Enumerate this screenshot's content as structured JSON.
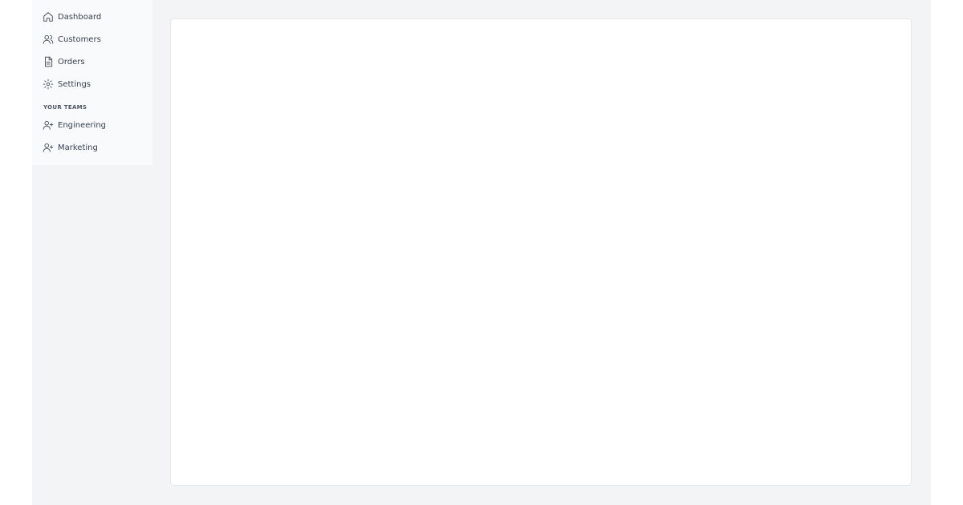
{
  "sidebar": {
    "nav_items": [
      {
        "label": "Dashboard",
        "icon": "home-icon"
      },
      {
        "label": "Customers",
        "icon": "users-icon"
      },
      {
        "label": "Orders",
        "icon": "document-icon"
      },
      {
        "label": "Settings",
        "icon": "gear-icon"
      }
    ],
    "teams_heading": "YOUR TEAMS",
    "teams": [
      {
        "label": "Engineering",
        "icon": "user-plus-icon"
      },
      {
        "label": "Marketing",
        "icon": "user-plus-icon"
      }
    ]
  },
  "colors": {
    "page_bg": "#f3f4f6",
    "sidebar_bg": "#f9fafb",
    "card_bg": "#ffffff",
    "text": "#374151"
  }
}
